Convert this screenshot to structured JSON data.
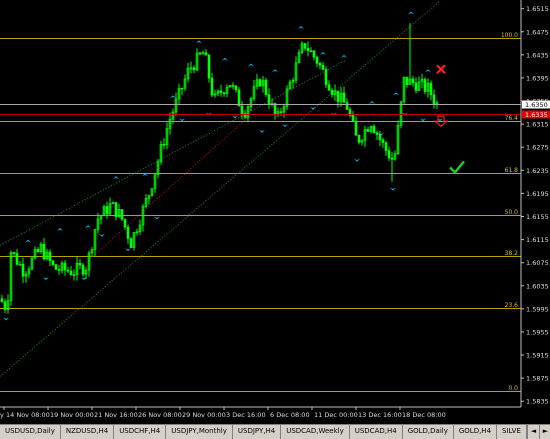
{
  "chart_data": {
    "type": "candlestick",
    "price_labels": [
      "1.6515",
      "1.6475",
      "1.6435",
      "1.6395",
      "1.6355",
      "1.6315",
      "1.6275",
      "1.6235",
      "1.6195",
      "1.6155",
      "1.6115",
      "1.6075",
      "1.6035",
      "1.5995",
      "1.5955",
      "1.5915",
      "1.5875",
      "1.5835"
    ],
    "price_range": [
      1.5825,
      1.653
    ],
    "current_price_label": "1.6350",
    "current_price": 1.635,
    "red_price_label": "1.6335",
    "red_price": 1.6333,
    "x_labels": [
      "14 Nov 08:00",
      "19 Nov 00:00",
      "21 Nov 16:00",
      "26 Nov 08:00",
      "29 Nov 00:00",
      "3 Dec 16:00",
      "6 Dec 08:00",
      "11 Dec 00:00",
      "13 Dec 16:00",
      "18 Dec 08:00"
    ],
    "x_label_left_partial": "y",
    "fib_levels": [
      {
        "label": "100.0",
        "price": 1.6465
      },
      {
        "label": "76.4",
        "price": 1.632
      },
      {
        "label": "61.8",
        "price": 1.6231
      },
      {
        "label": "50.0",
        "price": 1.6158
      },
      {
        "label": "38.2",
        "price": 1.6086
      },
      {
        "label": "23.6",
        "price": 1.5996
      },
      {
        "label": "0.0",
        "price": 1.5852
      }
    ],
    "colors": {
      "background": "#000000",
      "candle": "#00ff00",
      "fib_line": "#b8a400",
      "fib_label": "#d8c200",
      "fractal": "#00c8ff",
      "trend_green": "#1a9a1a",
      "trend_red": "#b01818",
      "current_line": "#a8a8a8",
      "red_line": "#c00000",
      "axis": "#c0c0c0",
      "cross_icon": "#ff2020",
      "check_icon": "#22cc22",
      "arrow_icon": "#ff2020"
    },
    "signals": [
      "cross-icon",
      "check-icon",
      "arrow-down-icon"
    ]
  },
  "tabs": [
    {
      "label": "USDUSD,Daily",
      "active": false
    },
    {
      "label": "NZDUSD,H4",
      "active": false
    },
    {
      "label": "USDCHF,H4",
      "active": false
    },
    {
      "label": "USDJPY,Monthly",
      "active": false
    },
    {
      "label": "USDJPY,H4",
      "active": false
    },
    {
      "label": "USDCAD,Weekly",
      "active": false
    },
    {
      "label": "USDCAD,H4",
      "active": false
    },
    {
      "label": "GOLD,Daily",
      "active": false
    },
    {
      "label": "GOLD,H4",
      "active": false
    },
    {
      "label": "SILVE",
      "active": false
    }
  ],
  "tab_nav": {
    "prev": "◄",
    "next": "►"
  }
}
